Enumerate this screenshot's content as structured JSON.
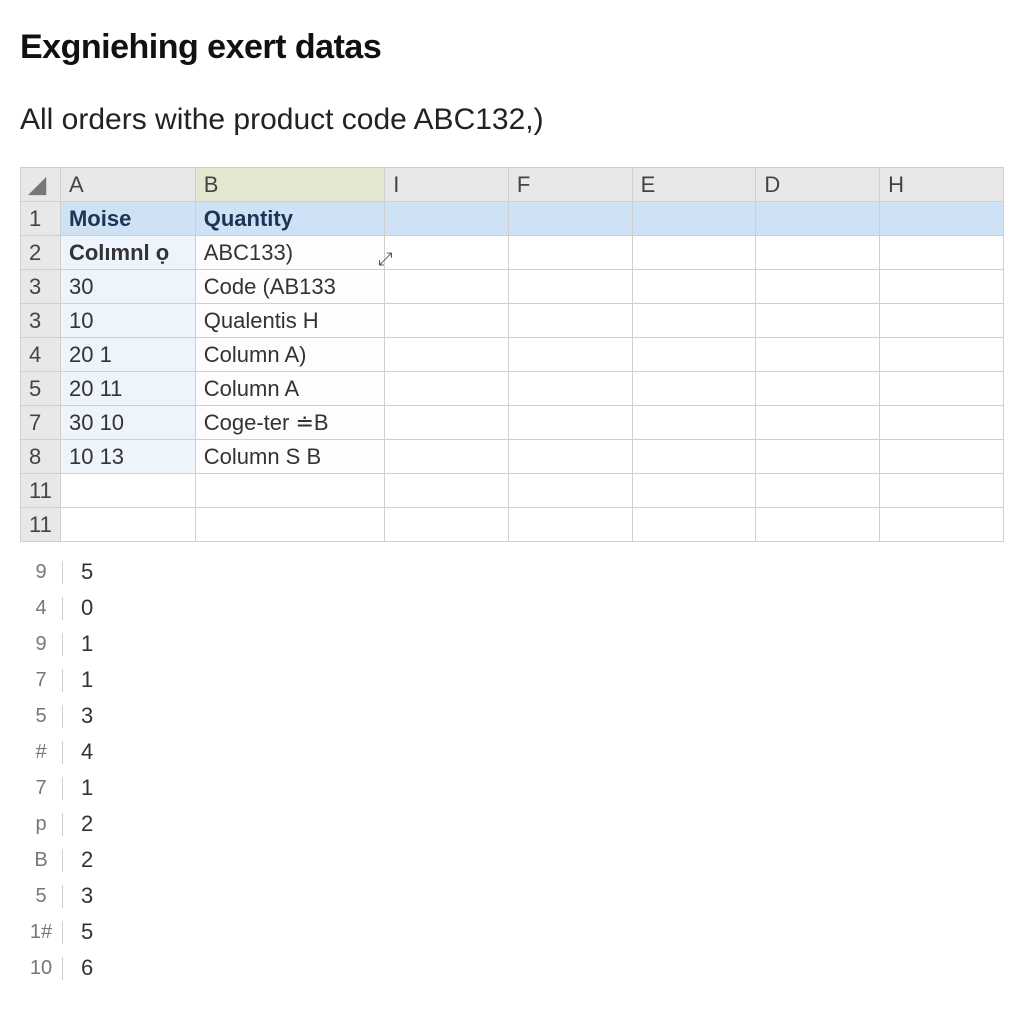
{
  "title": "Exgniehing exert datas",
  "subtitle": "All orders withe product code ABC132,)",
  "corner_glyph": "◢",
  "columns": [
    "A",
    "B",
    "I",
    "F",
    "E",
    "D",
    "H"
  ],
  "header_row_num": "1",
  "header_row": {
    "A": "Moise",
    "B": "Quantity"
  },
  "data_rows": [
    {
      "num": "2",
      "A": "Colımnl ọ",
      "B": "ABC133)"
    },
    {
      "num": "3",
      "A": "30",
      "B": "Code (AB133"
    },
    {
      "num": "3",
      "A": "10",
      "B": "Qualentis H"
    },
    {
      "num": "4",
      "A": "20 1",
      "B": "Column A)"
    },
    {
      "num": "5",
      "A": "20 11",
      "B": "Column A"
    },
    {
      "num": "7",
      "A": "30 10",
      "B": "Coge-ter ≐B"
    },
    {
      "num": "8",
      "A": "10 13",
      "B": "Column S B"
    }
  ],
  "tail_row_nums": [
    "11",
    "11"
  ],
  "loose_rows": [
    {
      "num": "9",
      "val": "5"
    },
    {
      "num": "4",
      "val": "0"
    },
    {
      "num": "9",
      "val": "1"
    },
    {
      "num": "7",
      "val": "1"
    },
    {
      "num": "5",
      "val": "3"
    },
    {
      "num": "#",
      "val": "4"
    },
    {
      "num": "7",
      "val": "1"
    },
    {
      "num": "p",
      "val": "2"
    },
    {
      "num": "B",
      "val": "2"
    },
    {
      "num": "5",
      "val": "3"
    },
    {
      "num": "1#",
      "val": "5"
    },
    {
      "num": "10",
      "val": "6"
    }
  ],
  "cursor_glyph": "⤢"
}
